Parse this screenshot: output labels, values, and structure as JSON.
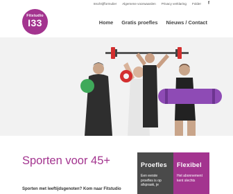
{
  "topbar": {
    "links": [
      "Inschrijfformulier",
      "Algemene voorwaarden",
      "Privacy verklaring",
      "Folder"
    ],
    "social_icon": "facebook-icon"
  },
  "logo": {
    "line1": "Fitstudio",
    "line2": "I33",
    "color": "#a3348f"
  },
  "nav": {
    "items": [
      "Home",
      "Gratis proefles",
      "Nieuws / Contact"
    ]
  },
  "hero": {
    "description": "Photo of four seniors posing with fitness equipment",
    "background": "#f2f2f2"
  },
  "main": {
    "headline": "Sporten voor 45+",
    "subline": "Sporten met leeftijdsgenoten? Kom naar Fitstudio"
  },
  "cards": [
    {
      "title": "Proefles",
      "text": "Een eerste proefles is op afspraak, je",
      "color": "#4a4a4a"
    },
    {
      "title": "Flexibel",
      "text": "Het abonnement kent slechts",
      "color": "#a3348f"
    }
  ]
}
